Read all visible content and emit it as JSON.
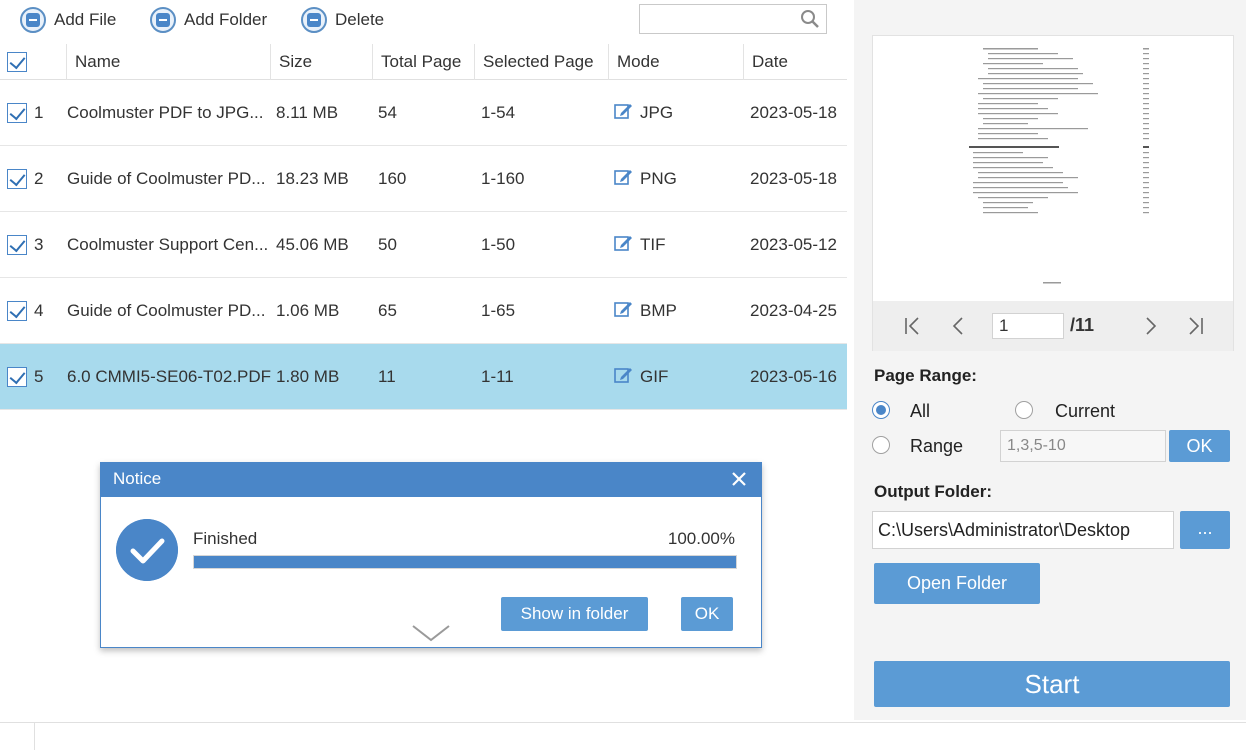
{
  "toolbar": {
    "add_file": "Add File",
    "add_folder": "Add Folder",
    "delete": "Delete"
  },
  "table": {
    "columns": [
      "Name",
      "Size",
      "Total Page",
      "Selected Page",
      "Mode",
      "Date"
    ],
    "rows": [
      {
        "index": "1",
        "name": "Coolmuster PDF to JPG...",
        "size": "8.11 MB",
        "total": "54",
        "selected": "1-54",
        "mode": "JPG",
        "date": "2023-05-18",
        "checked": true
      },
      {
        "index": "2",
        "name": "Guide of Coolmuster PD...",
        "size": "18.23 MB",
        "total": "160",
        "selected": "1-160",
        "mode": "PNG",
        "date": "2023-05-18",
        "checked": true
      },
      {
        "index": "3",
        "name": "Coolmuster Support Cen...",
        "size": "45.06 MB",
        "total": "50",
        "selected": "1-50",
        "mode": "TIF",
        "date": "2023-05-12",
        "checked": true
      },
      {
        "index": "4",
        "name": "Guide of Coolmuster PD...",
        "size": "1.06 MB",
        "total": "65",
        "selected": "1-65",
        "mode": "BMP",
        "date": "2023-04-25",
        "checked": true
      },
      {
        "index": "5",
        "name": "6.0 CMMI5-SE06-T02.PDF",
        "size": "1.80 MB",
        "total": "11",
        "selected": "1-11",
        "mode": "GIF",
        "date": "2023-05-16",
        "checked": true
      }
    ]
  },
  "notice": {
    "title": "Notice",
    "status": "Finished",
    "percent": "100.00%",
    "progress_fraction": 1.0,
    "show_in_folder": "Show in folder",
    "ok": "OK"
  },
  "preview": {
    "current_page": "1",
    "total_pages": "/11"
  },
  "page_range": {
    "label": "Page Range:",
    "all": "All",
    "current": "Current",
    "range": "Range",
    "range_value": "1,3,5-10",
    "ok": "OK",
    "selected": "All"
  },
  "output": {
    "label": "Output Folder:",
    "path": "C:\\Users\\Administrator\\Desktop",
    "browse": "...",
    "open_folder": "Open Folder"
  },
  "start": "Start",
  "colors": {
    "accent": "#4a86c8",
    "button": "#5b9bd5",
    "selected_row": "#a8daed"
  }
}
